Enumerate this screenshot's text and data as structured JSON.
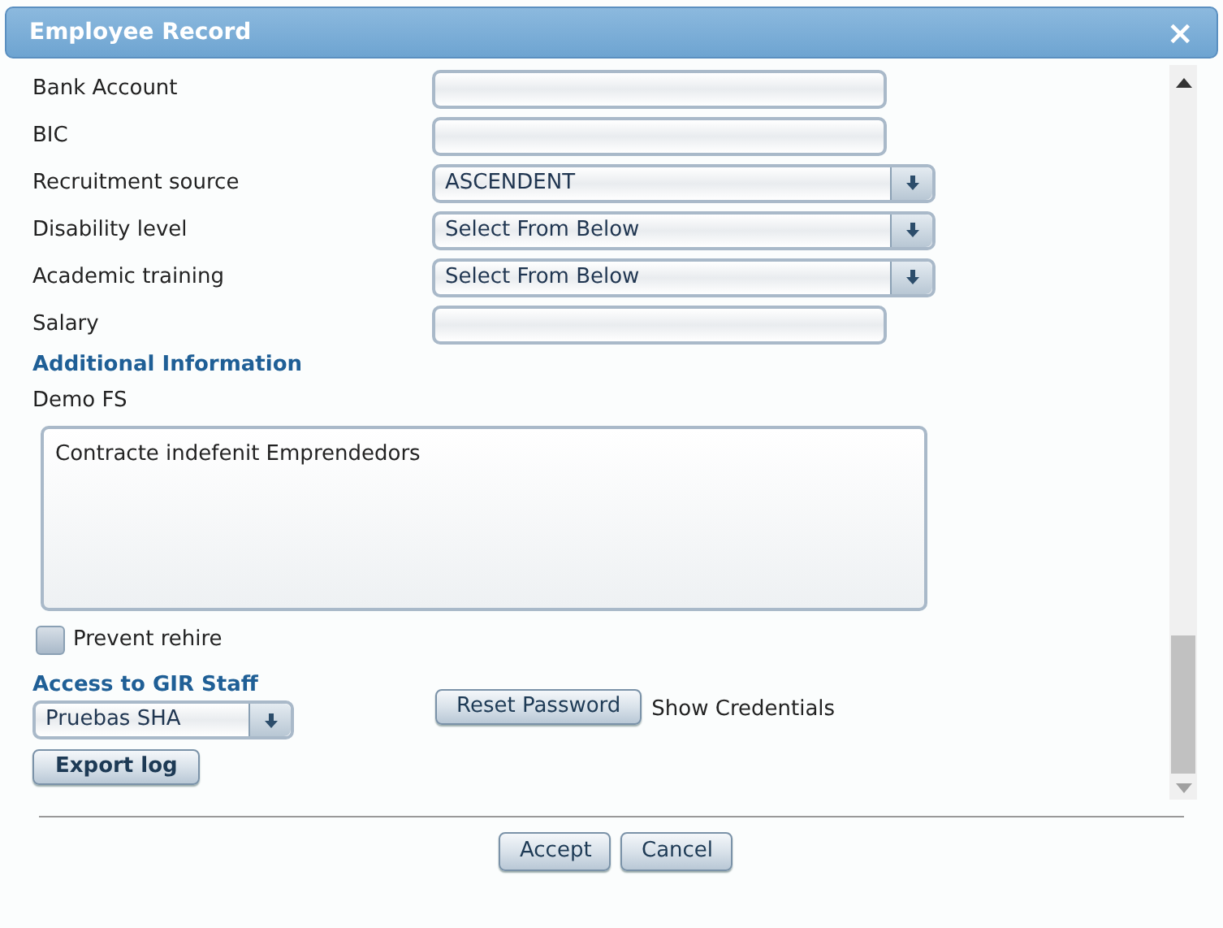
{
  "window": {
    "title": "Employee Record",
    "close": "×"
  },
  "fields": [
    {
      "label": "Bank Account",
      "kind": "text"
    },
    {
      "label": "BIC",
      "kind": "text"
    },
    {
      "label": "Recruitment source",
      "kind": "select",
      "value": "ASCENDENT"
    },
    {
      "label": "Disability level",
      "kind": "select",
      "value": "Select From Below"
    },
    {
      "label": "Academic training",
      "kind": "select",
      "value": "Select From Below"
    },
    {
      "label": "Salary",
      "kind": "text"
    }
  ],
  "additional": {
    "heading": "Additional Information",
    "label": "Demo FS",
    "value": "Contracte indefenit Emprendedors"
  },
  "prevent_rehire": {
    "label": "Prevent rehire",
    "checked": false
  },
  "access": {
    "heading": "Access to GIR Staff",
    "value": "Pruebas SHA",
    "reset_button": "Reset Password",
    "show_credentials": "Show Credentials"
  },
  "export_button": "Export log",
  "buttons": [
    "Accept",
    "Cancel"
  ]
}
